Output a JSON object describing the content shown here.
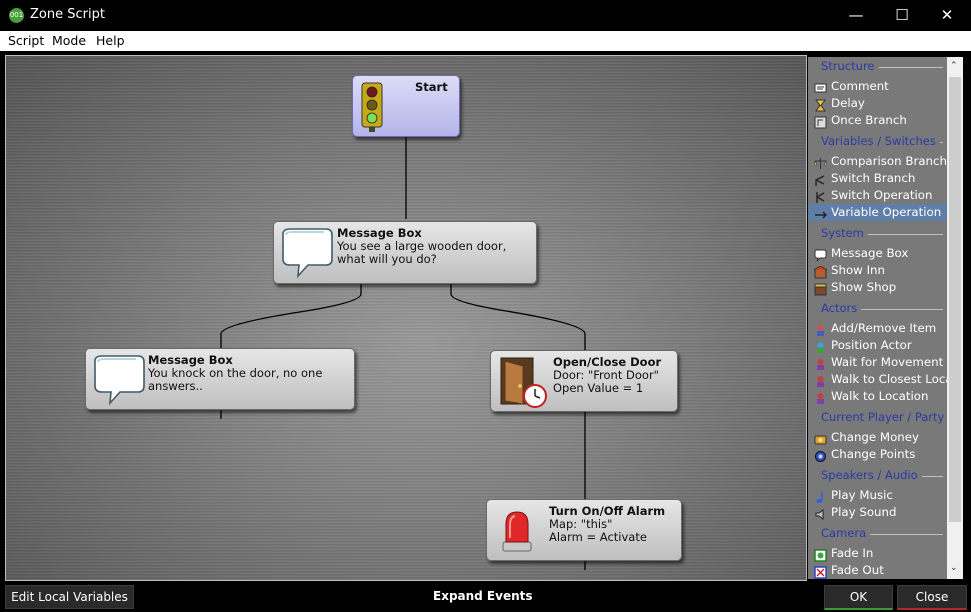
{
  "window": {
    "title": "Zone Script",
    "icon_text": "001",
    "minimize": "—",
    "maximize": "☐",
    "close": "✕"
  },
  "menu": [
    "Script",
    "Mode",
    "Help"
  ],
  "nodes": {
    "start": {
      "title": "Start",
      "icon": "traffic-light-icon"
    },
    "message1": {
      "title": "Message Box",
      "lines": [
        "You see a large wooden door,",
        "what will you do?"
      ],
      "icon": "speech-bubble-icon"
    },
    "message2": {
      "title": "Message Box",
      "lines": [
        "You knock on the door, no one",
        "answers.."
      ],
      "icon": "speech-bubble-icon"
    },
    "door": {
      "title": "Open/Close Door",
      "lines": [
        "Door: \"Front Door\"",
        "Open Value = 1"
      ],
      "icon": "door-clock-icon"
    },
    "alarm": {
      "title": "Turn On/Off Alarm",
      "lines": [
        "Map: \"this\"",
        "Alarm = Activate"
      ],
      "icon": "alarm-siren-icon"
    }
  },
  "palette": {
    "categories": [
      {
        "name": "Structure",
        "items": [
          {
            "label": "Comment",
            "icon": "comment-icon"
          },
          {
            "label": "Delay",
            "icon": "hourglass-icon"
          },
          {
            "label": "Once Branch",
            "icon": "once-branch-icon"
          }
        ]
      },
      {
        "name": "Variables / Switches",
        "items": [
          {
            "label": "Comparison Branch",
            "icon": "scale-icon"
          },
          {
            "label": "Switch Branch",
            "icon": "switch-branch-icon"
          },
          {
            "label": "Switch Operation",
            "icon": "switch-operation-icon"
          },
          {
            "label": "Variable Operation",
            "icon": "variable-operation-icon",
            "selected": true
          }
        ]
      },
      {
        "name": "System",
        "items": [
          {
            "label": "Message Box",
            "icon": "message-box-icon"
          },
          {
            "label": "Show Inn",
            "icon": "inn-icon"
          },
          {
            "label": "Show Shop",
            "icon": "shop-icon"
          }
        ]
      },
      {
        "name": "Actors",
        "items": [
          {
            "label": "Add/Remove Item",
            "icon": "item-icon"
          },
          {
            "label": "Position Actor",
            "icon": "position-actor-icon"
          },
          {
            "label": "Wait for Movement",
            "icon": "wait-movement-icon"
          },
          {
            "label": "Walk to Closest Loca",
            "icon": "walk-closest-icon"
          },
          {
            "label": "Walk to Location",
            "icon": "walk-location-icon"
          }
        ]
      },
      {
        "name": "Current Player / Party",
        "items": [
          {
            "label": "Change Money",
            "icon": "money-icon"
          },
          {
            "label": "Change Points",
            "icon": "points-icon"
          }
        ]
      },
      {
        "name": "Speakers / Audio",
        "items": [
          {
            "label": "Play Music",
            "icon": "music-note-icon"
          },
          {
            "label": "Play Sound",
            "icon": "speaker-icon"
          }
        ]
      },
      {
        "name": "Camera",
        "items": [
          {
            "label": "Fade In",
            "icon": "fade-in-icon"
          },
          {
            "label": "Fade Out",
            "icon": "fade-out-icon"
          }
        ]
      }
    ]
  },
  "bottom": {
    "edit_vars": "Edit Local Variables",
    "expand_events": "Expand Events",
    "ok": "OK",
    "close": "Close"
  },
  "colors": {
    "category_text": "#2a3aa6",
    "selected_item": "#5f7fa8",
    "start_node": "#c8c8f0",
    "ok_underline": "#3a9a3a",
    "close_underline": "#b02a2a"
  }
}
